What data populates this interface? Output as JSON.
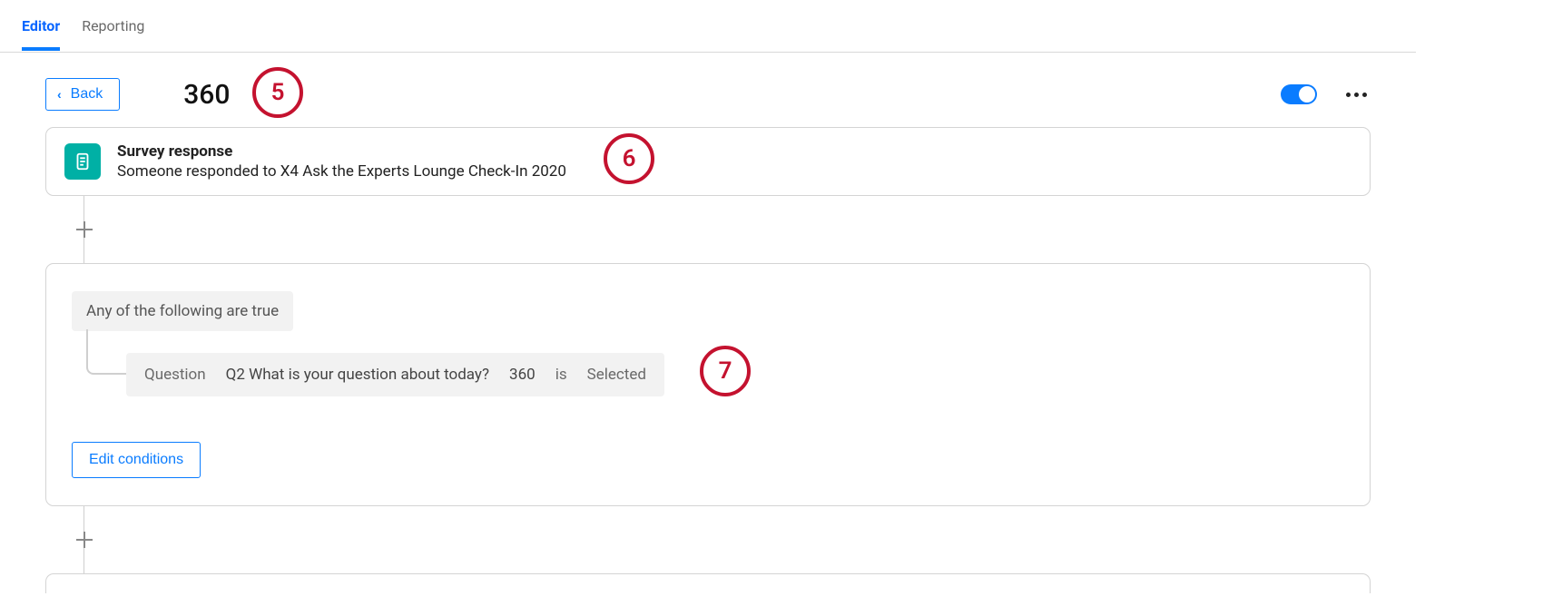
{
  "tabs": {
    "editor_label": "Editor",
    "reporting_label": "Reporting"
  },
  "back_label": "Back",
  "title": "360",
  "trigger": {
    "title": "Survey response",
    "description": "Someone responded to X4 Ask the Experts Lounge Check-In 2020"
  },
  "condition": {
    "header_label": "Any of the following are true",
    "row": {
      "type_label": "Question",
      "question_text": "Q2 What is your question about today?",
      "option_value": "360",
      "operator_word": "is",
      "state_value": "Selected"
    },
    "edit_label": "Edit conditions"
  },
  "annotations": {
    "five": "5",
    "six": "6",
    "seven": "7"
  }
}
